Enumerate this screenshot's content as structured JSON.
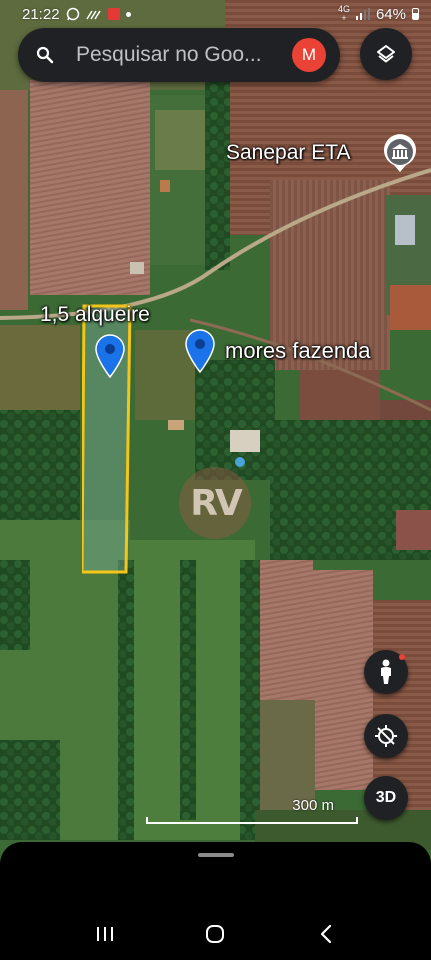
{
  "status_bar": {
    "time": "21:22",
    "network_top": "4G",
    "network_bottom": "+",
    "battery": "64%",
    "notification_icons": [
      "whatsapp-icon",
      "wifi-calling-icon",
      "red-app-icon",
      "dot-icon"
    ],
    "system_icons": [
      "signal-icon",
      "battery-icon"
    ]
  },
  "search": {
    "placeholder": "Pesquisar no Goo...",
    "avatar_initial": "M",
    "avatar_color": "#ea4335"
  },
  "map": {
    "type": "satellite",
    "poi": {
      "label": "Sanepar ETA",
      "icon": "government-building-icon",
      "marker_color": "#ffffff"
    },
    "plot": {
      "label": "1,5 alqueire",
      "outline_color": "#f5c518"
    },
    "placemarks": [
      {
        "label": "",
        "color": "#1a73e8"
      },
      {
        "label": "mores fazenda",
        "color": "#1a73e8"
      }
    ],
    "watermark": "RV",
    "scale_label": "300 m"
  },
  "controls": {
    "layers_icon": "layers-icon",
    "streetview_icon": "pegman-icon",
    "compass_icon": "location-disabled-icon",
    "tilt_label": "3D"
  },
  "nav_bar": {
    "icons": [
      "recent-apps-icon",
      "home-icon",
      "back-icon"
    ]
  }
}
